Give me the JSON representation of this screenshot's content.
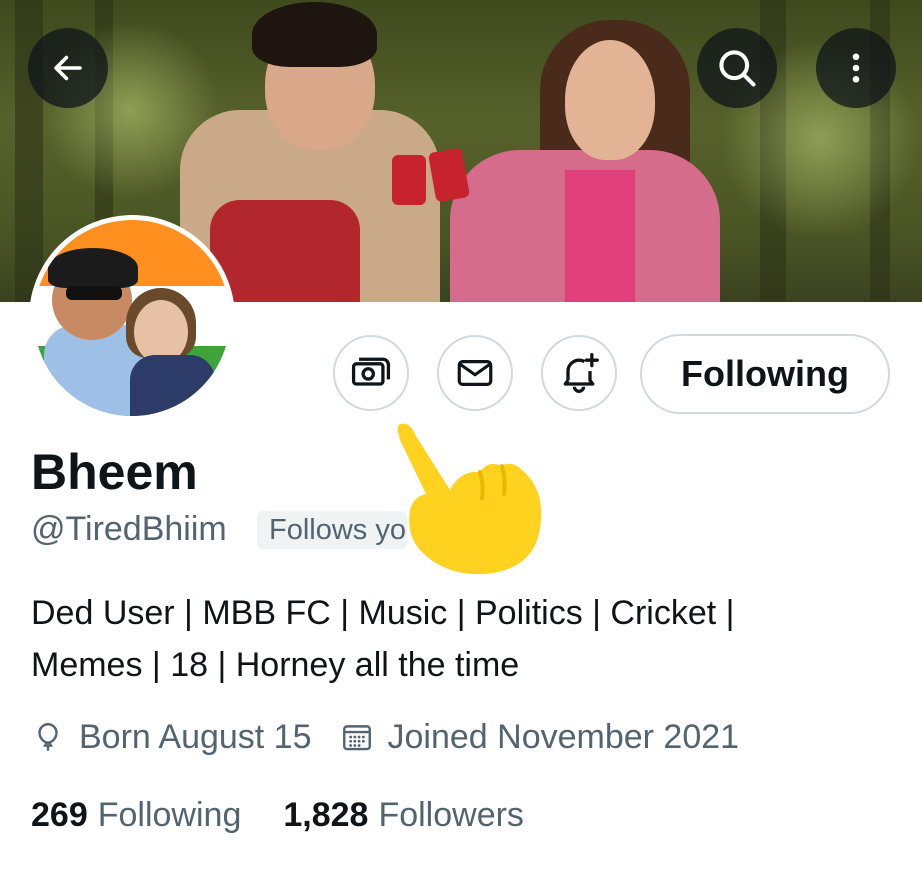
{
  "header": {
    "back_icon": "arrow-left-icon",
    "search_icon": "search-icon",
    "more_icon": "more-vertical-icon"
  },
  "profile": {
    "name": "Bheem",
    "handle": "@TiredBhiim",
    "follows_you_label": "Follows you",
    "bio_line1": "Ded User | MBB FC | Music | Politics | Cricket |",
    "bio_line2": "Memes | 18 | Horney all the time",
    "birthday": "Born August 15",
    "joined": "Joined November 2021",
    "following_count": "269",
    "following_label": "Following",
    "followers_count": "1,828",
    "followers_label": "Followers"
  },
  "actions": {
    "tip_icon": "money-icon",
    "message_icon": "envelope-icon",
    "notify_icon": "bell-plus-icon",
    "follow_button_label": "Following"
  },
  "overlay": {
    "pointer_icon": "pointing-hand-emoji"
  },
  "colors": {
    "text_primary": "#0f1419",
    "text_secondary": "#536471",
    "border": "#cfd9de",
    "badge_bg": "#eff3f4",
    "emoji_yellow": "#ffd21f"
  }
}
